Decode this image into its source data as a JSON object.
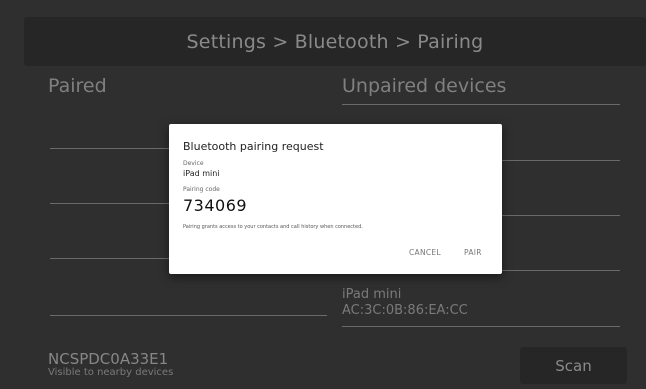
{
  "header": {
    "breadcrumb": "Settings > Bluetooth > Pairing"
  },
  "paired": {
    "title": "Paired"
  },
  "unpaired": {
    "title": "Unpaired devices",
    "devices": [
      {
        "name": "iPad mini",
        "address": "AC:3C:0B:86:EA:CC"
      }
    ]
  },
  "footer": {
    "device_id": "NCSPDC0A33E1",
    "visibility": "Visible to nearby devices",
    "scan_label": "Scan"
  },
  "dialog": {
    "title": "Bluetooth pairing request",
    "device_label": "Device",
    "device_name": "iPad mini",
    "code_label": "Pairing code",
    "code": "734069",
    "note": "Pairing grants access to your contacts and call history when connected.",
    "cancel_label": "CANCEL",
    "pair_label": "PAIR"
  }
}
